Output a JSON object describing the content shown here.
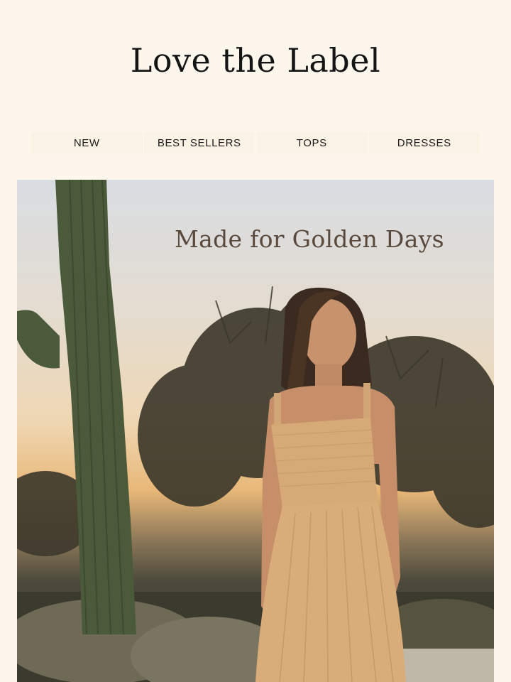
{
  "brand": {
    "logo_text": "Love the Label"
  },
  "nav": {
    "items": [
      {
        "label": "NEW"
      },
      {
        "label": "BEST SELLERS"
      },
      {
        "label": "TOPS"
      },
      {
        "label": "DRESSES"
      }
    ]
  },
  "hero": {
    "headline": "Made for Golden Days",
    "image_subject": "woman in tan smocked sundress standing in desert beside saguaro cactus at sunset"
  },
  "colors": {
    "page_background": "#fcf6ec",
    "logo_text": "#151515",
    "headline_text": "#5a4a3e",
    "dress": "#d7ad7a"
  }
}
